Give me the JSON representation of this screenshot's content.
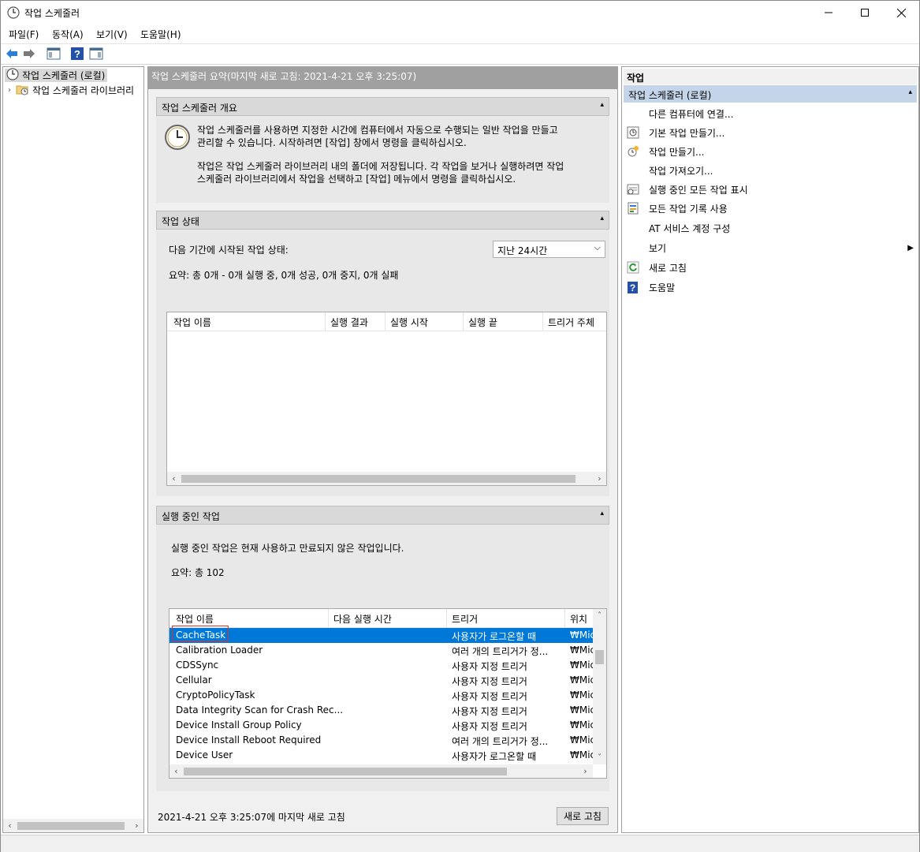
{
  "window": {
    "title": "작업 스케줄러"
  },
  "menu": [
    "파일(F)",
    "동작(A)",
    "보기(V)",
    "도움말(H)"
  ],
  "tree": {
    "root": "작업 스케줄러 (로컬)",
    "child": "작업 스케줄러 라이브러리"
  },
  "center": {
    "header": "작업 스케줄러 요약(마지막 새로 고침: 2021-4-21 오후 3:25:07)",
    "overview": {
      "title": "작업 스케줄러 개요",
      "p1a": "작업 스케줄러를 사용하면 지정한 시간에 컴퓨터에서 자동으로 수행되는 일반 작업을 만들고",
      "p1b": "관리할 수 있습니다. 시작하려면 [작업] 창에서 명령을 클릭하십시오.",
      "p2a": "작업은 작업 스케줄러 라이브러리 내의 폴더에 저장됩니다. 각 작업을 보거나 실행하려면 작업",
      "p2b": "스케줄러 라이브러리에서 작업을 선택하고 [작업] 메뉴에서 명령을 클릭하십시오."
    },
    "status": {
      "title": "작업 상태",
      "period_label": "다음 기간에 시작된 작업 상태:",
      "period_value": "지난 24시간",
      "summary": "요약: 총 0개 - 0개 실행 중, 0개 성공, 0개 중지, 0개 실패",
      "columns": [
        "작업 이름",
        "실행 결과",
        "실행 시작",
        "실행 끝",
        "트리거 주체"
      ]
    },
    "running": {
      "title": "실행 중인 작업",
      "desc": "실행 중인 작업은 현재 사용하고 만료되지 않은 작업입니다.",
      "summary": "요약: 총 102",
      "columns": [
        "작업 이름",
        "다음 실행 시간",
        "트리거",
        "위치"
      ],
      "rows": [
        {
          "name": "CacheTask",
          "next": "",
          "trigger": "사용자가 로그온할 때",
          "loc": "₩Mic"
        },
        {
          "name": "Calibration Loader",
          "next": "",
          "trigger": "여러 개의 트리거가 정...",
          "loc": "₩Mic"
        },
        {
          "name": "CDSSync",
          "next": "",
          "trigger": "사용자 지정 트리거",
          "loc": "₩Mic"
        },
        {
          "name": "Cellular",
          "next": "",
          "trigger": "사용자 지정 트리거",
          "loc": "₩Mic"
        },
        {
          "name": "CryptoPolicyTask",
          "next": "",
          "trigger": "사용자 지정 트리거",
          "loc": "₩Mic"
        },
        {
          "name": "Data Integrity Scan for Crash Rec...",
          "next": "",
          "trigger": "사용자 지정 트리거",
          "loc": "₩Mic"
        },
        {
          "name": "Device Install Group Policy",
          "next": "",
          "trigger": "사용자 지정 트리거",
          "loc": "₩Mic"
        },
        {
          "name": "Device Install Reboot Required",
          "next": "",
          "trigger": "여러 개의 트리거가 정...",
          "loc": "₩Mic"
        },
        {
          "name": "Device User",
          "next": "",
          "trigger": "사용자가 로그온할 때",
          "loc": "₩Mic"
        }
      ]
    },
    "footer": {
      "text": "2021-4-21 오후 3:25:07에 마지막 새로 고침",
      "refresh": "새로 고침"
    }
  },
  "actions": {
    "header": "작업",
    "group": "작업 스케줄러 (로컬)",
    "items": [
      "다른 컴퓨터에 연결...",
      "기본 작업 만들기...",
      "작업 만들기...",
      "작업 가져오기...",
      "실행 중인 모든 작업 표시",
      "모든 작업 기록 사용",
      "AT 서비스 계정 구성",
      "보기",
      "새로 고침",
      "도움말"
    ]
  }
}
